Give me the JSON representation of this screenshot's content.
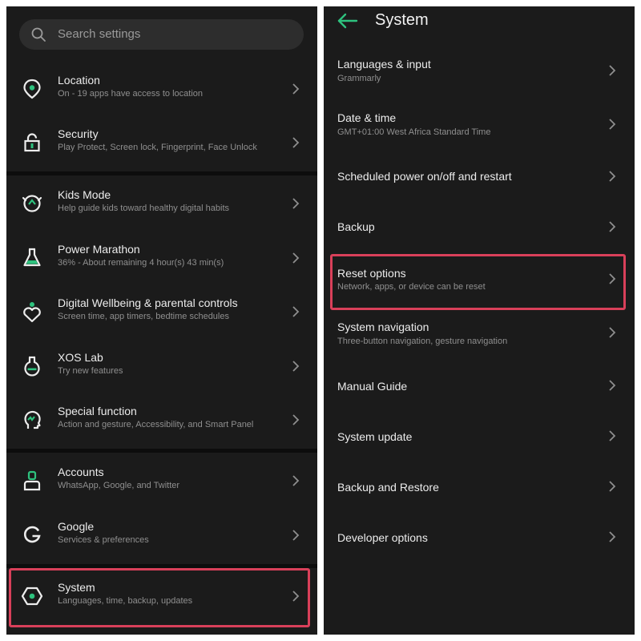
{
  "colors": {
    "accent": "#2ec27e",
    "highlight": "#d9405a",
    "background": "#1b1b1b"
  },
  "search": {
    "placeholder": "Search settings",
    "icon": "search-icon"
  },
  "left_items": [
    {
      "title": "Location",
      "subtitle": "On - 19 apps have access to location",
      "icon": "location-icon"
    },
    {
      "title": "Security",
      "subtitle": "Play Protect, Screen lock, Fingerprint, Face Unlock",
      "icon": "lock-icon"
    },
    {
      "title": "Kids Mode",
      "subtitle": "Help guide kids toward healthy digital habits",
      "icon": "kids-mode-icon"
    },
    {
      "title": "Power Marathon",
      "subtitle": "36% - About remaining 4 hour(s)  43 min(s)",
      "icon": "flask-icon"
    },
    {
      "title": "Digital Wellbeing & parental controls",
      "subtitle": "Screen time, app timers, bedtime schedules",
      "icon": "wellbeing-heart-icon"
    },
    {
      "title": "XOS Lab",
      "subtitle": "Try new features",
      "icon": "lab-flask-icon"
    },
    {
      "title": "Special function",
      "subtitle": "Action and gesture, Accessibility, and Smart Panel",
      "icon": "head-gesture-icon"
    },
    {
      "title": "Accounts",
      "subtitle": "WhatsApp, Google, and Twitter",
      "icon": "account-icon"
    },
    {
      "title": "Google",
      "subtitle": "Services & preferences",
      "icon": "google-icon"
    },
    {
      "title": "System",
      "subtitle": "Languages, time, backup, updates",
      "icon": "system-hexagon-icon"
    }
  ],
  "right_header": {
    "title": "System",
    "back_icon": "back-arrow-icon"
  },
  "right_items": [
    {
      "title": "Languages & input",
      "subtitle": "Grammarly"
    },
    {
      "title": "Date & time",
      "subtitle": "GMT+01:00 West Africa Standard Time"
    },
    {
      "title": "Scheduled power on/off and restart",
      "subtitle": ""
    },
    {
      "title": "Backup",
      "subtitle": ""
    },
    {
      "title": "Reset options",
      "subtitle": "Network, apps, or device can be reset"
    },
    {
      "title": "System navigation",
      "subtitle": "Three-button navigation, gesture navigation"
    },
    {
      "title": "Manual Guide",
      "subtitle": ""
    },
    {
      "title": "System update",
      "subtitle": ""
    },
    {
      "title": "Backup and Restore",
      "subtitle": ""
    },
    {
      "title": "Developer options",
      "subtitle": ""
    }
  ]
}
